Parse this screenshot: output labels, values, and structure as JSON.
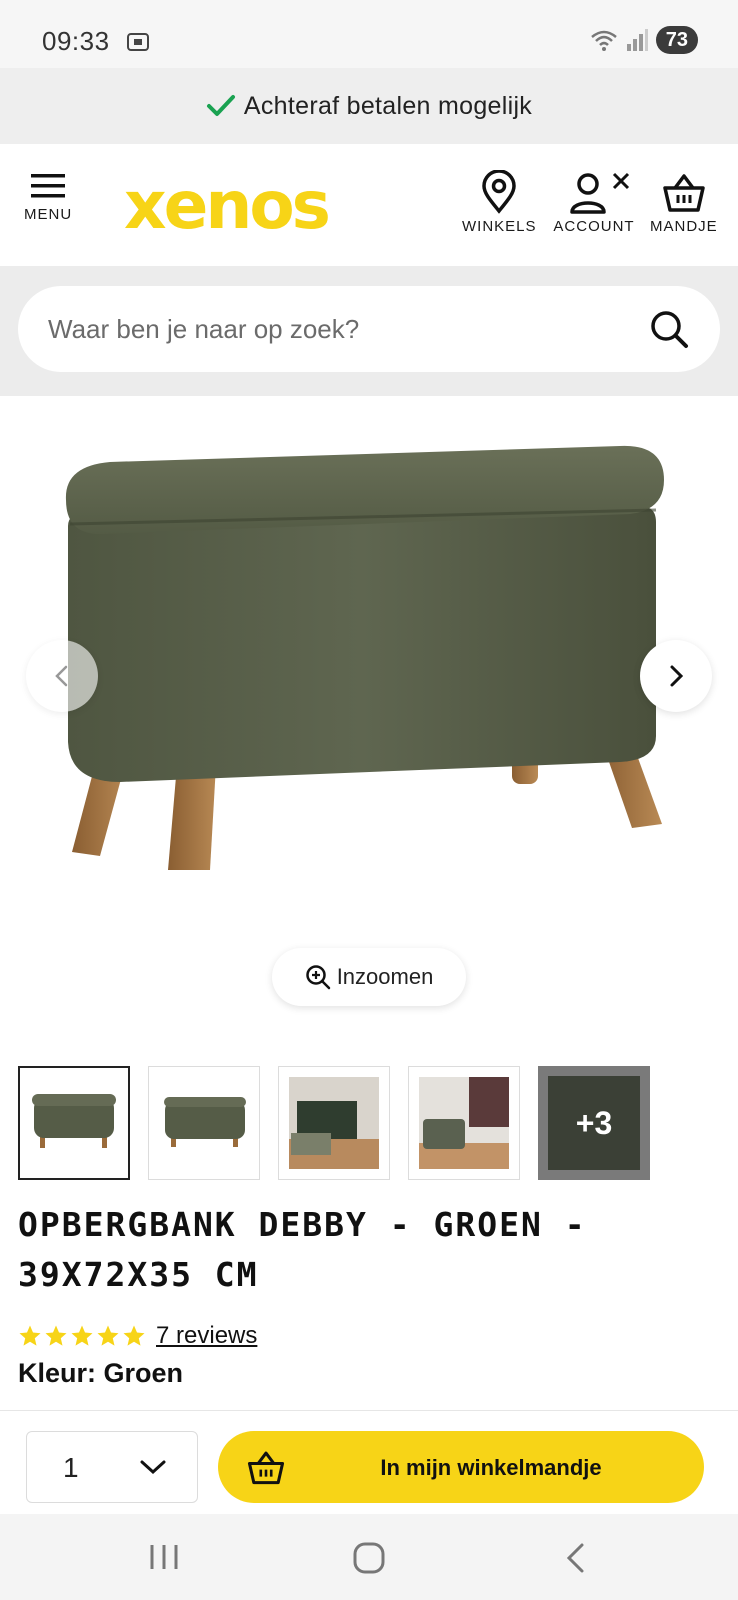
{
  "status_bar": {
    "time": "09:33",
    "battery": "73"
  },
  "promo": {
    "text": "Achteraf betalen mogelijk",
    "check_color": "#1aa251"
  },
  "header": {
    "menu_label": "MENU",
    "logo_text": "xenos",
    "stores_label": "WINKELS",
    "account_label": "ACCOUNT",
    "cart_label": "MANDJE",
    "brand_color": "#f7d417"
  },
  "search": {
    "placeholder": "Waar ben je naar op zoek?"
  },
  "gallery": {
    "zoom_label": "Inzoomen",
    "more_count": "+3"
  },
  "product": {
    "title_line1": "OPBERGBANK DEBBY - GROEN -",
    "title_line2": "39X72X35 CM",
    "rating": 5,
    "reviews_label": "7 reviews",
    "color_label": "Kleur: Groen"
  },
  "buy": {
    "quantity": "1",
    "cart_button_label": "In mijn winkelmandje"
  }
}
